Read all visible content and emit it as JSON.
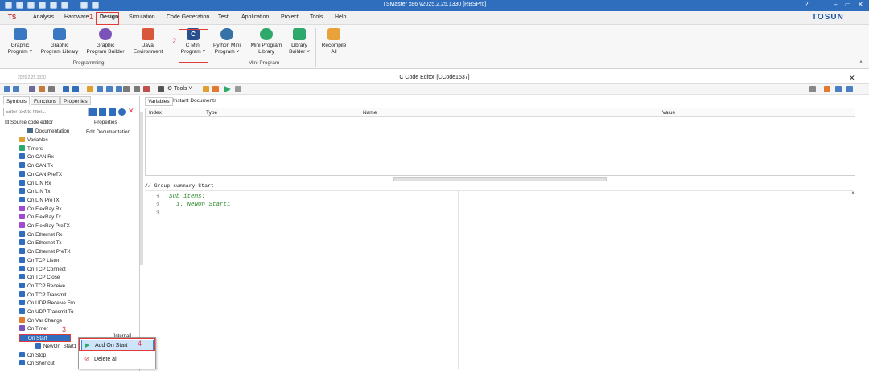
{
  "titlebar": {
    "title": "TSMaster x86 v2025.2.25.1330 [RBSPro]",
    "help": "?",
    "min": "–",
    "max": "▭",
    "close": "✕"
  },
  "menu": {
    "logo": "TS",
    "items": [
      "Analysis",
      "Hardware",
      "Design",
      "Simulation",
      "Code Generation",
      "Test",
      "Application",
      "Project",
      "Tools",
      "Help"
    ],
    "brand": "TOSUN"
  },
  "annotations": {
    "n1": "1",
    "n2": "2",
    "n3": "3",
    "n4": "4"
  },
  "ribbon": {
    "buttons": [
      {
        "l1": "Graphic",
        "l2": "Program ˅"
      },
      {
        "l1": "Graphic",
        "l2": "Program Library"
      },
      {
        "l1": "Graphic",
        "l2": "Program Builder"
      },
      {
        "l1": "Java",
        "l2": "Environment"
      },
      {
        "l1": "C Mini",
        "l2": "Program ˅"
      },
      {
        "l1": "Python Mini",
        "l2": "Program ˅"
      },
      {
        "l1": "Mini Program",
        "l2": "Library"
      },
      {
        "l1": "Library",
        "l2": "Builder ˅"
      },
      {
        "l1": "Recompile",
        "l2": "All"
      }
    ],
    "groups": {
      "programming": "Programming",
      "mini": "Mini Program"
    }
  },
  "editor": {
    "title": "C Code Editor [CCode1537]",
    "version": "2025.2.25.1330",
    "tools": "Tools",
    "close": "✕"
  },
  "left": {
    "tabs": [
      "Symbols",
      "Functions",
      "Properties"
    ],
    "filter_placeholder": "Enter text to filter...",
    "root": "Source code editor",
    "root_prop": "Properties",
    "documentation": "Documentation",
    "edit_doc": "Edit Documentation",
    "items": [
      "Variables",
      "Timers",
      "On CAN Rx",
      "On CAN Tx",
      "On CAN PreTX",
      "On LIN Rx",
      "On LIN Tx",
      "On LIN PreTX",
      "On FlexRay Rx",
      "On FlexRay Tx",
      "On FlexRay PreTX",
      "On Ethernet Rx",
      "On Ethernet Tx",
      "On Ethernet PreTX",
      "On TCP Listen",
      "On TCP Connect",
      "On TCP Close",
      "On TCP Receive",
      "On TCP Transmit",
      "On UDP Receive Fro",
      "On UDP Transmit To",
      "On Var Change",
      "On Timer",
      "On Start",
      "NewOn_Start1",
      "On Stop",
      "On Shortcut"
    ],
    "internal": "[Internal]"
  },
  "right": {
    "tabs": [
      "Variables",
      "Instant Documents"
    ],
    "columns": [
      "Index",
      "Type",
      "Name",
      "Value"
    ],
    "group_summary": "// Group summary Start",
    "lines": [
      "1",
      "2",
      "3"
    ],
    "code": [
      "Sub items:",
      "  1. NewOn_Start1",
      ""
    ]
  },
  "context": {
    "items": [
      "Add On Start",
      "Delete all"
    ]
  }
}
